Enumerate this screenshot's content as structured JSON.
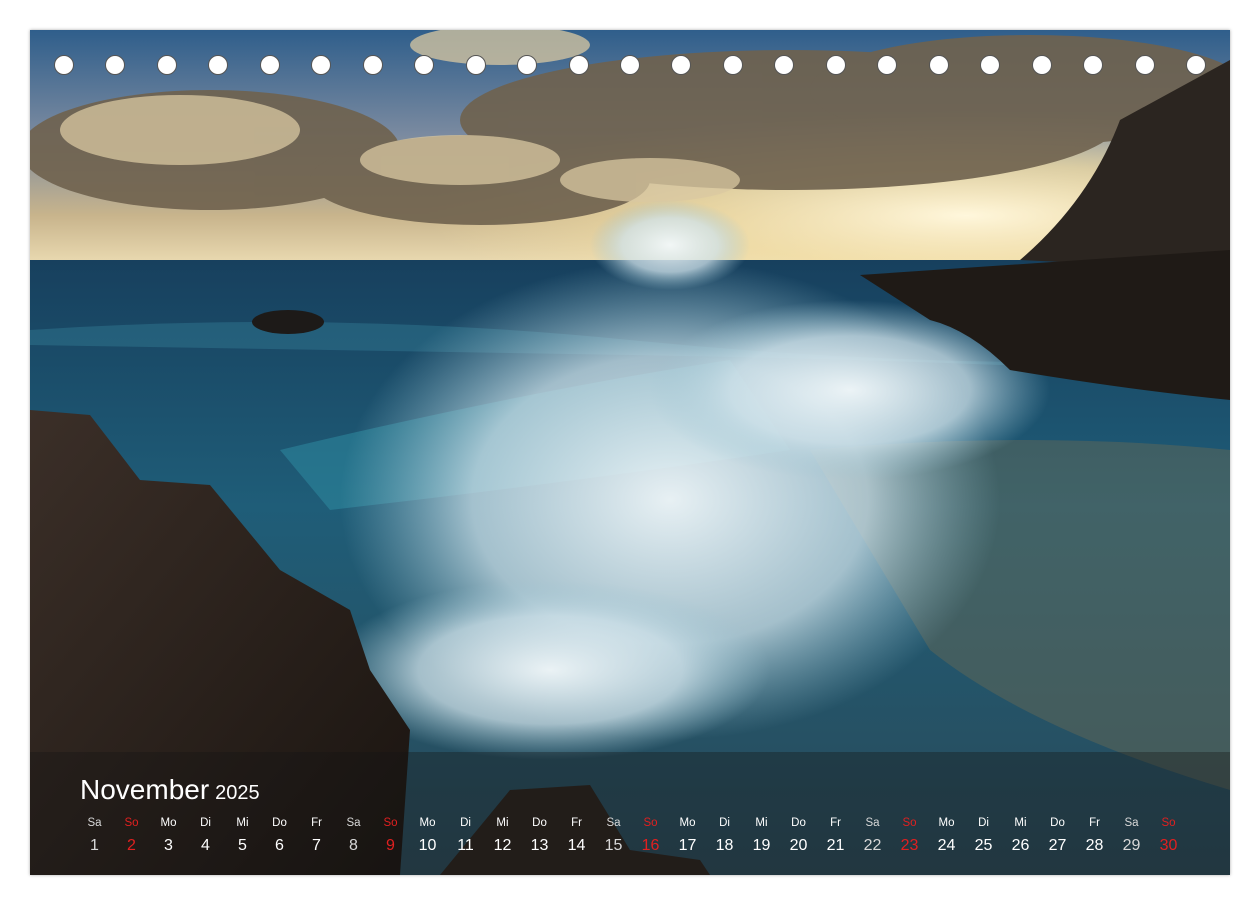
{
  "calendar": {
    "month": "November",
    "year": "2025",
    "colors": {
      "weekday": "#ffffff",
      "sunday": "#e02020",
      "saturday": "#d8d8d8"
    },
    "days": [
      {
        "wd": "Sa",
        "d": "1",
        "type": "sat"
      },
      {
        "wd": "So",
        "d": "2",
        "type": "sun"
      },
      {
        "wd": "Mo",
        "d": "3",
        "type": "wk"
      },
      {
        "wd": "Di",
        "d": "4",
        "type": "wk"
      },
      {
        "wd": "Mi",
        "d": "5",
        "type": "wk"
      },
      {
        "wd": "Do",
        "d": "6",
        "type": "wk"
      },
      {
        "wd": "Fr",
        "d": "7",
        "type": "wk"
      },
      {
        "wd": "Sa",
        "d": "8",
        "type": "sat"
      },
      {
        "wd": "So",
        "d": "9",
        "type": "sun"
      },
      {
        "wd": "Mo",
        "d": "10",
        "type": "wk"
      },
      {
        "wd": "Di",
        "d": "11",
        "type": "wk"
      },
      {
        "wd": "Mi",
        "d": "12",
        "type": "wk"
      },
      {
        "wd": "Do",
        "d": "13",
        "type": "wk"
      },
      {
        "wd": "Fr",
        "d": "14",
        "type": "wk"
      },
      {
        "wd": "Sa",
        "d": "15",
        "type": "sat"
      },
      {
        "wd": "So",
        "d": "16",
        "type": "sun"
      },
      {
        "wd": "Mo",
        "d": "17",
        "type": "wk"
      },
      {
        "wd": "Di",
        "d": "18",
        "type": "wk"
      },
      {
        "wd": "Mi",
        "d": "19",
        "type": "wk"
      },
      {
        "wd": "Do",
        "d": "20",
        "type": "wk"
      },
      {
        "wd": "Fr",
        "d": "21",
        "type": "wk"
      },
      {
        "wd": "Sa",
        "d": "22",
        "type": "sat"
      },
      {
        "wd": "So",
        "d": "23",
        "type": "sun"
      },
      {
        "wd": "Mo",
        "d": "24",
        "type": "wk"
      },
      {
        "wd": "Di",
        "d": "25",
        "type": "wk"
      },
      {
        "wd": "Mi",
        "d": "26",
        "type": "wk"
      },
      {
        "wd": "Do",
        "d": "27",
        "type": "wk"
      },
      {
        "wd": "Fr",
        "d": "28",
        "type": "wk"
      },
      {
        "wd": "Sa",
        "d": "29",
        "type": "sat"
      },
      {
        "wd": "So",
        "d": "30",
        "type": "sun"
      }
    ]
  },
  "binding": {
    "hole_count": 23
  },
  "photo": {
    "palette": {
      "sky_top": "#3c6e9a",
      "cloud": "#8a7a62",
      "sunlight": "#f3e6c2",
      "sea": "#1f5a78",
      "foam": "#e8f1f4",
      "rock": "#2a211c"
    }
  }
}
